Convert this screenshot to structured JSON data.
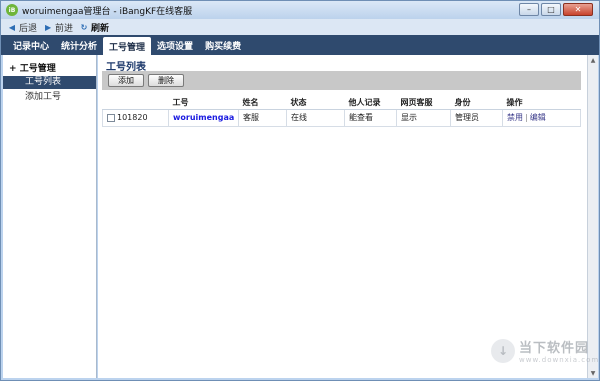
{
  "window": {
    "title": "woruimengaa管理台 - iBangKF在线客服",
    "app_icon": "iB"
  },
  "navbar": {
    "back": "后退",
    "forward": "前进",
    "refresh": "刷新"
  },
  "menu": [
    {
      "label": "记录中心"
    },
    {
      "label": "统计分析"
    },
    {
      "label": "工号管理"
    },
    {
      "label": "选项设置"
    },
    {
      "label": "购买续费"
    }
  ],
  "sidebar": {
    "section": "工号管理",
    "items": [
      {
        "label": "工号列表"
      },
      {
        "label": "添加工号"
      }
    ]
  },
  "content": {
    "title": "工号列表",
    "buttons": {
      "add": "添加",
      "delete": "删除"
    },
    "columns": [
      "",
      "工号",
      "姓名",
      "状态",
      "他人记录",
      "网页客服",
      "身份",
      "操作"
    ],
    "rows": [
      {
        "id": "101820",
        "username": "woruimengaa",
        "name": "客服",
        "status": "在线",
        "others_records": "能查看",
        "web_service": "显示",
        "role": "管理员",
        "op_disable": "禁用",
        "op_edit": "编辑"
      }
    ]
  },
  "watermark": {
    "title": "当下软件园",
    "subtitle": "www.downxia.com"
  },
  "colors": {
    "menu_bg": "#2f4a6e",
    "title_blue": "#1e3a6c",
    "link_blue": "#1a1ae0"
  }
}
